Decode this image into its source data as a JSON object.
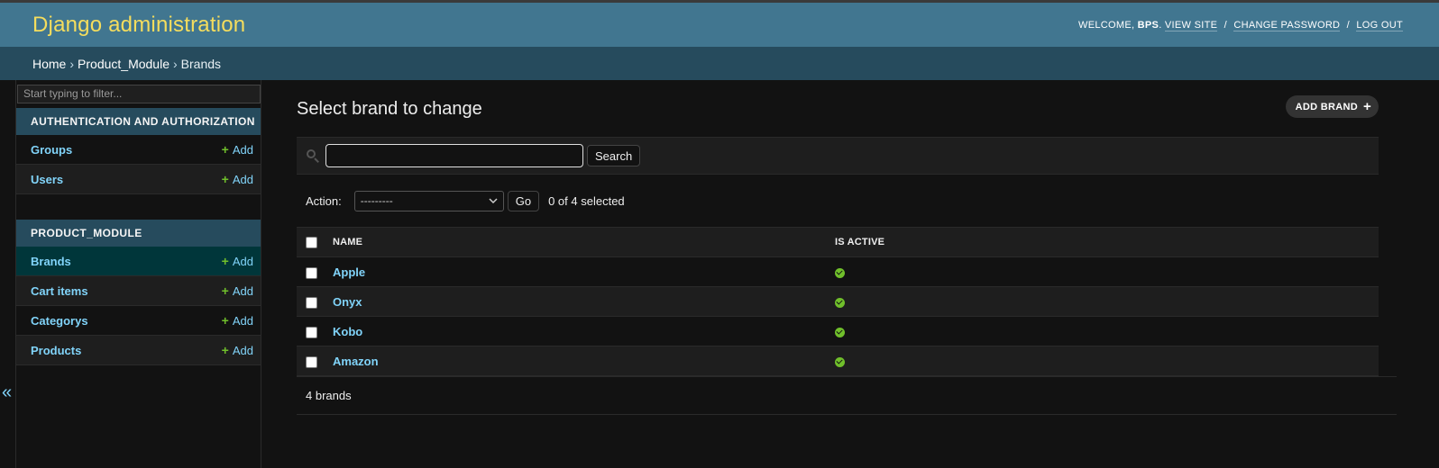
{
  "header": {
    "site_name": "Django administration",
    "welcome": "Welcome,",
    "username": "BPS",
    "view_site": "View site",
    "change_password": "Change password",
    "log_out": "Log out",
    "separator": "/"
  },
  "breadcrumbs": {
    "home": "Home",
    "app": "Product_Module",
    "current": "Brands",
    "separator": "›"
  },
  "sidebar": {
    "filter_placeholder": "Start typing to filter...",
    "collapse_glyph": "«",
    "add_label": "Add",
    "apps": [
      {
        "caption": "Authentication and Authorization",
        "models": [
          {
            "name": "Groups"
          },
          {
            "name": "Users"
          }
        ]
      },
      {
        "caption": "Product_Module",
        "models": [
          {
            "name": "Brands"
          },
          {
            "name": "Cart items"
          },
          {
            "name": "Categorys"
          },
          {
            "name": "Products"
          }
        ]
      }
    ]
  },
  "content": {
    "title": "Select brand to change",
    "add_button": "Add brand",
    "search_button": "Search",
    "search_value": "",
    "action_label": "Action:",
    "action_selected": "---------",
    "go_button": "Go",
    "selected_count": "0 of 4 selected",
    "columns": [
      "Name",
      "Is active"
    ],
    "rows": [
      {
        "name": "Apple",
        "is_active": true
      },
      {
        "name": "Onyx",
        "is_active": true
      },
      {
        "name": "Kobo",
        "is_active": true
      },
      {
        "name": "Amazon",
        "is_active": true
      }
    ],
    "paginator": "4 brands"
  },
  "colors": {
    "header_bg": "#417690",
    "breadcrumb_bg": "#264b5d",
    "brand_text": "#f5dd5d",
    "link": "#81d4fa",
    "add_plus": "#70bf2b",
    "active_icon": "#70bf2b",
    "page_bg": "#121212"
  }
}
